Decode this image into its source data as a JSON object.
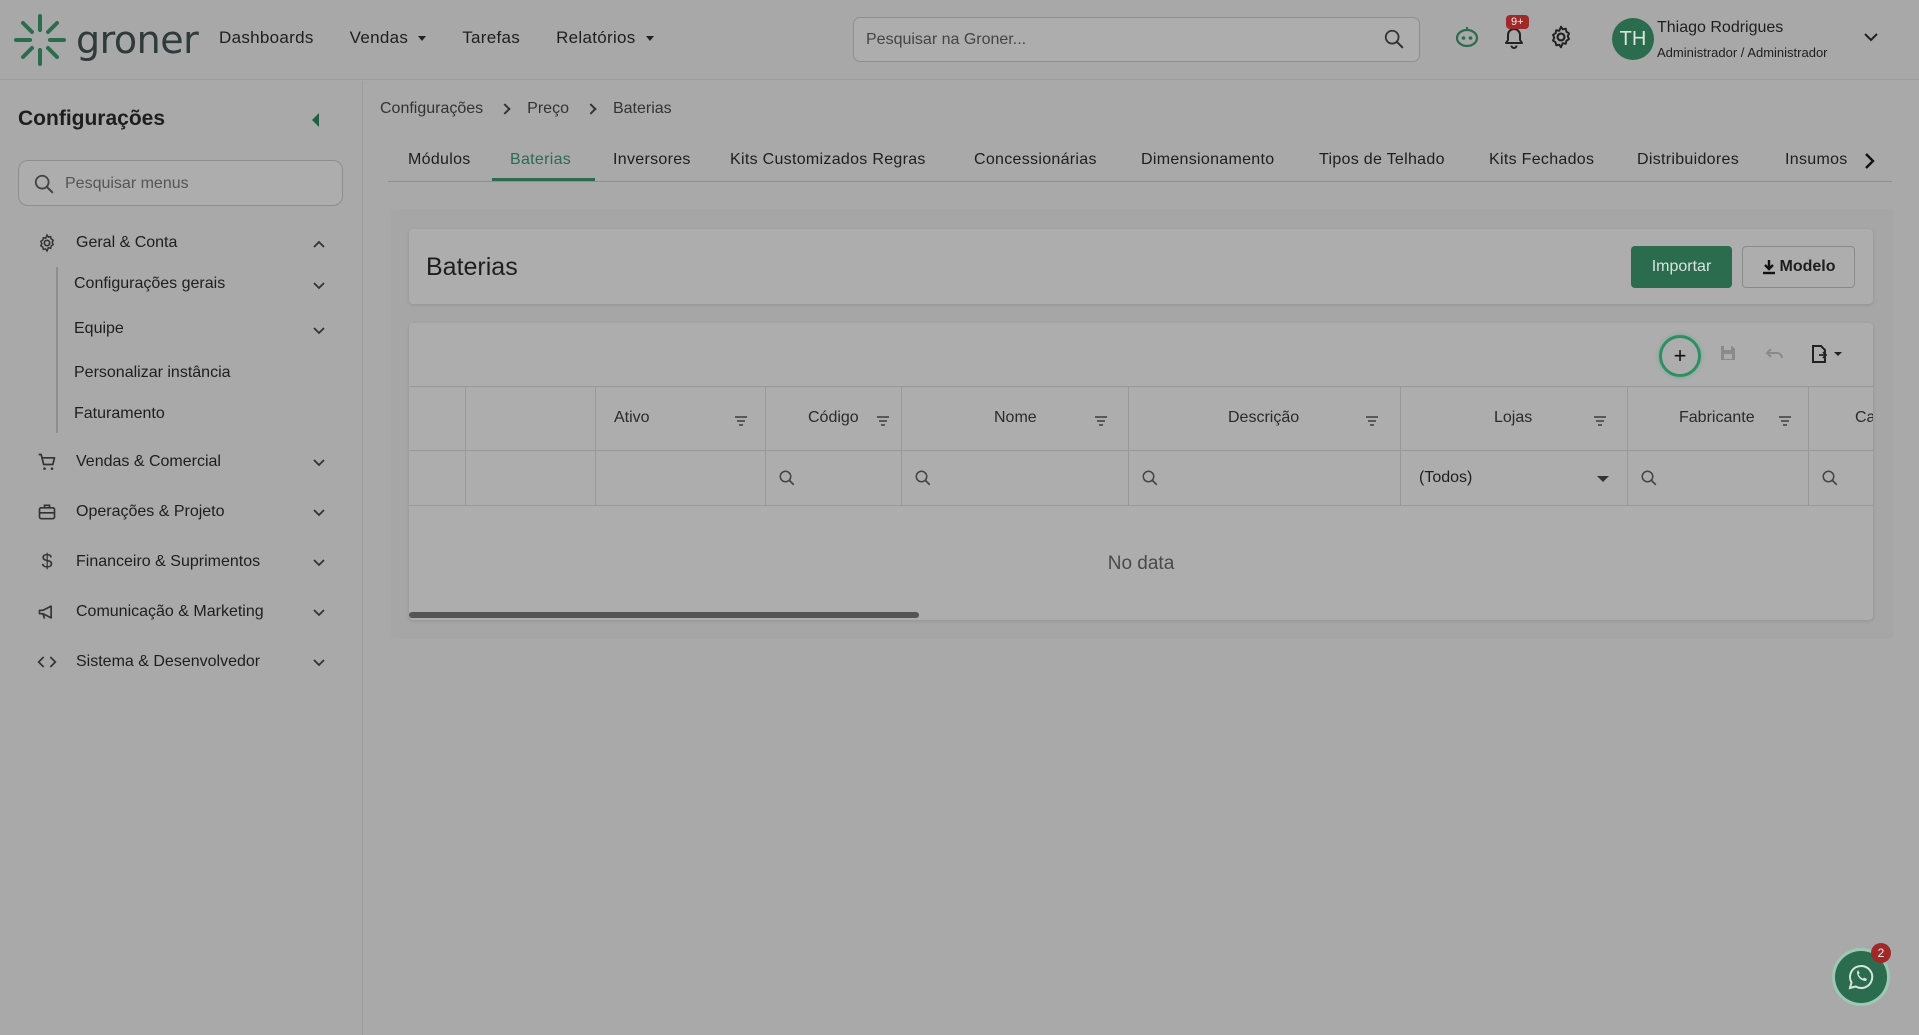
{
  "header": {
    "logo_text": "groner",
    "nav": [
      {
        "label": "Dashboards"
      },
      {
        "label": "Vendas"
      },
      {
        "label": "Tarefas"
      },
      {
        "label": "Relatórios"
      }
    ],
    "search_placeholder": "Pesquisar na Groner...",
    "notifications_badge": "9+",
    "user": {
      "initials": "TH",
      "name": "Thiago Rodrigues",
      "role": "Administrador / Administrador"
    },
    "icons": [
      "assistant-icon",
      "bell-icon",
      "gear-icon",
      "chevron-down-icon"
    ]
  },
  "sidebar": {
    "title": "Configurações",
    "search_placeholder": "Pesquisar menus",
    "sections": [
      {
        "label": "Geral & Conta",
        "icon": "gear-icon",
        "expanded": true,
        "children": [
          {
            "label": "Configurações gerais",
            "has_children": true
          },
          {
            "label": "Equipe",
            "has_children": true
          },
          {
            "label": "Personalizar instância",
            "has_children": false
          },
          {
            "label": "Faturamento",
            "has_children": false
          }
        ]
      },
      {
        "label": "Vendas & Comercial",
        "icon": "cart-icon"
      },
      {
        "label": "Operações & Projeto",
        "icon": "briefcase-icon"
      },
      {
        "label": "Financeiro & Suprimentos",
        "icon": "dollar-icon"
      },
      {
        "label": "Comunicação & Marketing",
        "icon": "megaphone-icon"
      },
      {
        "label": "Sistema & Desenvolvedor",
        "icon": "code-icon"
      }
    ]
  },
  "breadcrumb": [
    "Configurações",
    "Preço",
    "Baterias"
  ],
  "tabs": [
    {
      "label": "Módulos"
    },
    {
      "label": "Baterias",
      "active": true
    },
    {
      "label": "Inversores"
    },
    {
      "label": "Kits Customizados Regras"
    },
    {
      "label": "Concessionárias"
    },
    {
      "label": "Dimensionamento"
    },
    {
      "label": "Tipos de Telhado"
    },
    {
      "label": "Kits Fechados"
    },
    {
      "label": "Distribuidores"
    },
    {
      "label": "Insumos"
    }
  ],
  "page": {
    "title": "Baterias",
    "import_label": "Importar",
    "modelo_label": "Modelo"
  },
  "grid": {
    "columns": [
      "Ativo",
      "Código",
      "Nome",
      "Descrição",
      "Lojas",
      "Fabricante",
      "Ca"
    ],
    "lojas_filter_value": "(Todos)",
    "empty_text": "No data",
    "toolbar_icons": [
      "add-icon",
      "save-icon",
      "undo-icon",
      "export-icon"
    ]
  },
  "chat_badge": "2",
  "colors": {
    "accent": "#2b6b4e",
    "background": "#a9a9a9",
    "badge": "#a02828"
  }
}
